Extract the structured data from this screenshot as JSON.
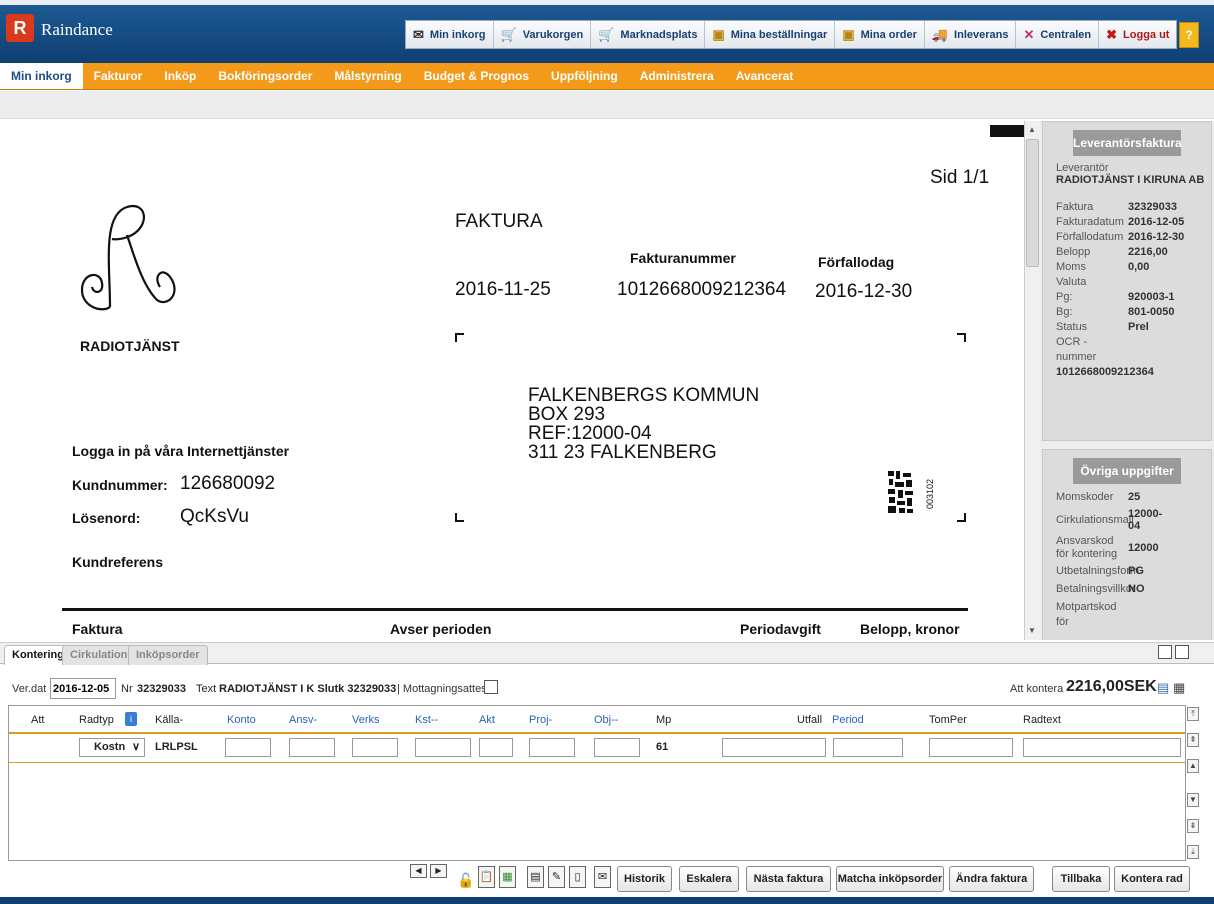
{
  "header": {
    "logo_glyph": "R",
    "app_name": "Raindance",
    "toolbar": [
      {
        "label": "Min inkorg",
        "icon": "inbox-icon",
        "glyph": "✉"
      },
      {
        "label": "Varukorgen",
        "icon": "cart-icon",
        "glyph": "🛒"
      },
      {
        "label": "Marknadsplats",
        "icon": "market-cart-icon",
        "glyph": "🛒"
      },
      {
        "label": "Mina beställningar",
        "icon": "orders-book-icon",
        "glyph": "▣"
      },
      {
        "label": "Mina order",
        "icon": "order-book-icon",
        "glyph": "▣"
      },
      {
        "label": "Inleverans",
        "icon": "truck-icon",
        "glyph": "🚚"
      },
      {
        "label": "Centralen",
        "icon": "central-icon",
        "glyph": "✕"
      },
      {
        "label": "Logga ut",
        "icon": "logout-icon",
        "glyph": "✖"
      }
    ],
    "help": "?"
  },
  "nav": [
    "Min inkorg",
    "Fakturor",
    "Inköp",
    "Bokföringsorder",
    "Målstyrning",
    "Budget & Prognos",
    "Uppföljning",
    "Administrera",
    "Avancerat"
  ],
  "invoice": {
    "page": "Sid 1/1",
    "title": "FAKTURA",
    "date": "2016-11-25",
    "number_label": "Fakturanummer",
    "number": "1012668009212364",
    "due_label": "Förfallodag",
    "due": "2016-12-30",
    "logo_text": "RADIOTJÄNST",
    "recipient": [
      "FALKENBERGS KOMMUN",
      "BOX 293",
      "REF:12000-04",
      "311 23 FALKENBERG"
    ],
    "login_title": "Logga in på våra Internettjänster",
    "kund_label": "Kundnummer:",
    "kund_value": "126680092",
    "pw_label": "Lösenord:",
    "pw_value": "QcKsVu",
    "kundref": "Kundreferens",
    "barcode_text": "003102",
    "col_faktura": "Faktura",
    "col_avser": "Avser perioden",
    "col_period": "Periodavgift",
    "col_belopp": "Belopp, kronor"
  },
  "supplier": {
    "title": "Leverantörsfaktura",
    "lev_label": "Leverantör",
    "lev_value": "RADIOTJÄNST I KIRUNA AB",
    "rows": [
      {
        "k": "Faktura",
        "v": "32329033"
      },
      {
        "k": "Fakturadatum",
        "v": "2016-12-05"
      },
      {
        "k": "Förfallodatum",
        "v": "2016-12-30"
      },
      {
        "k": "Belopp",
        "v": "2216,00"
      },
      {
        "k": "Moms",
        "v": "0,00"
      },
      {
        "k": "Valuta",
        "v": ""
      },
      {
        "k": "Pg:",
        "v": "920003-1"
      },
      {
        "k": "Bg:",
        "v": "801-0050"
      },
      {
        "k": "Status",
        "v": "Prel"
      },
      {
        "k": "OCR - nummer",
        "v": ""
      }
    ],
    "ocr": "1012668009212364"
  },
  "other": {
    "title": "Övriga uppgifter",
    "rows": [
      {
        "k": "Momskoder",
        "v": "25"
      },
      {
        "k": "Cirkulationsmall",
        "v": "12000-04"
      },
      {
        "k": "Ansvarskod för kontering",
        "v": "12000"
      },
      {
        "k": "Utbetalningsform",
        "v": "PG"
      },
      {
        "k": "Betalningsvillkor",
        "v": "NO"
      },
      {
        "k": "Motpartskod för",
        "v": ""
      }
    ]
  },
  "tabs": [
    "Kontering",
    "Cirkulation",
    "Inköpsorder"
  ],
  "form": {
    "verdat_label": "Ver.dat",
    "verdat_value": "2016-12-05",
    "nr_label": "Nr",
    "nr_value": "32329033",
    "text_label": "Text",
    "text_value": "RADIOTJÄNST I K Slutk 32329033",
    "mott_label": "| Mottagningsattest",
    "att_label": "Att kontera",
    "att_value": "2216,00SEK"
  },
  "grid": {
    "headers": [
      "Att",
      "Radtyp",
      "Källa-",
      "Konto",
      "Ansv-",
      "Verks",
      "Kst--",
      "Akt",
      "Proj-",
      "Obj--",
      "Mp",
      "Utfall",
      "Period",
      "TomPer",
      "Radtext"
    ],
    "row": {
      "radtyp": "Kostn",
      "kalla": "LRLPSL",
      "mp": "61"
    }
  },
  "buttons": [
    "Historik",
    "Eskalera",
    "Nästa faktura",
    "Matcha inköpsorder",
    "Ändra faktura",
    "Tillbaka",
    "Kontera rad"
  ]
}
